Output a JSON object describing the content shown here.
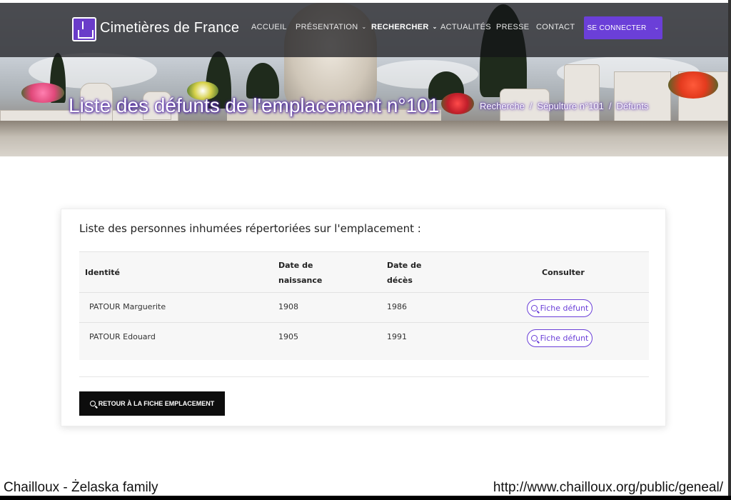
{
  "header": {
    "brand": "Cimetières de France",
    "nav": [
      {
        "label": "ACCUEIL",
        "dropdown": false
      },
      {
        "label": "PRÉSENTATION",
        "dropdown": true
      },
      {
        "label": "RECHERCHER",
        "dropdown": true,
        "active": true
      },
      {
        "label": "ACTUALITÉS",
        "dropdown": false
      },
      {
        "label": "PRESSE",
        "dropdown": false
      },
      {
        "label": "CONTACT",
        "dropdown": false
      }
    ],
    "connect_label": "SE CONNECTER",
    "accent_color": "#6b3fd8"
  },
  "hero": {
    "title": "Liste des défunts de l'emplacement n°101",
    "breadcrumb": [
      "Recherche",
      "Sépulture n°101",
      "Défunts"
    ],
    "breadcrumb_separator": "/"
  },
  "card": {
    "title": "Liste des personnes inhumées répertoriées sur l'emplacement :",
    "columns": {
      "identity": "Identité",
      "birth_line1": "Date de",
      "birth_line2": "naissance",
      "death_line1": "Date de",
      "death_line2": "décès",
      "consult": "Consulter"
    },
    "rows": [
      {
        "name": "PATOUR Marguerite",
        "birth": "1908",
        "death": "1986",
        "action": "Fiche défunt"
      },
      {
        "name": "PATOUR Edouard",
        "birth": "1905",
        "death": "1991",
        "action": "Fiche défunt"
      }
    ],
    "back_button": "RETOUR À LA FICHE EMPLACEMENT"
  },
  "watermark": {
    "left": "Chailloux - Żelaska  family",
    "right": "http://www.chailloux.org/public/geneal/"
  },
  "icons": {
    "search": "magnifier-icon",
    "chevron": "chevron-down-icon",
    "logo": "cemetery-logo-icon"
  }
}
